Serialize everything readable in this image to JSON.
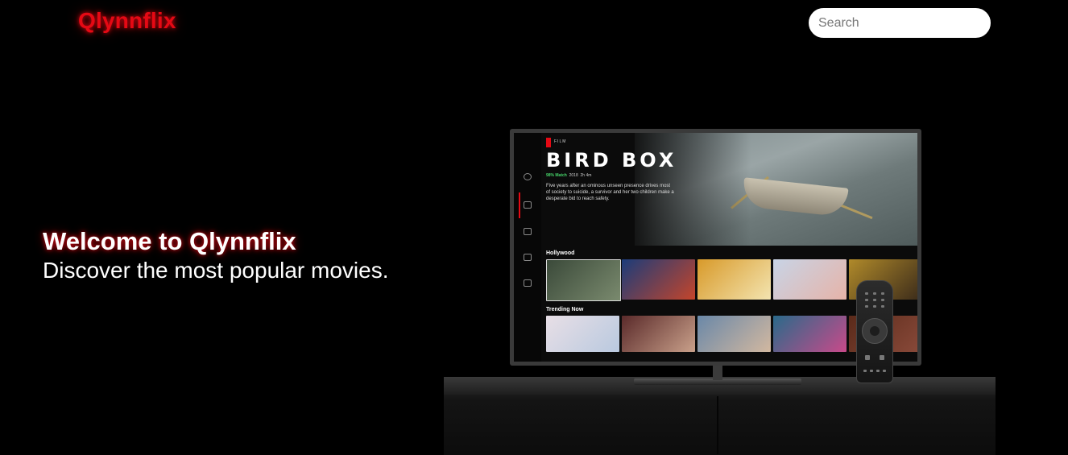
{
  "header": {
    "logo": "Qlynnflix",
    "search_placeholder": "Search"
  },
  "hero": {
    "title": "Welcome to Qlynnflix",
    "subtitle": "Discover the most popular movies."
  },
  "tv_screen": {
    "film_tag": "FILM",
    "movie_title": "BIRD BOX",
    "match": "98% Match",
    "year": "2018",
    "duration": "2h 4m",
    "description": "Five years after an ominous unseen presence drives most of society to suicide, a survivor and her two children make a desperate bid to reach safety.",
    "row1_label": "Hollywood",
    "row2_label": "Trending Now",
    "nav_icons": [
      "search-icon",
      "home-icon",
      "tv-icon",
      "film-icon",
      "list-icon"
    ]
  },
  "colors": {
    "brand": "#e50914",
    "background": "#000000",
    "match_green": "#46d369"
  }
}
